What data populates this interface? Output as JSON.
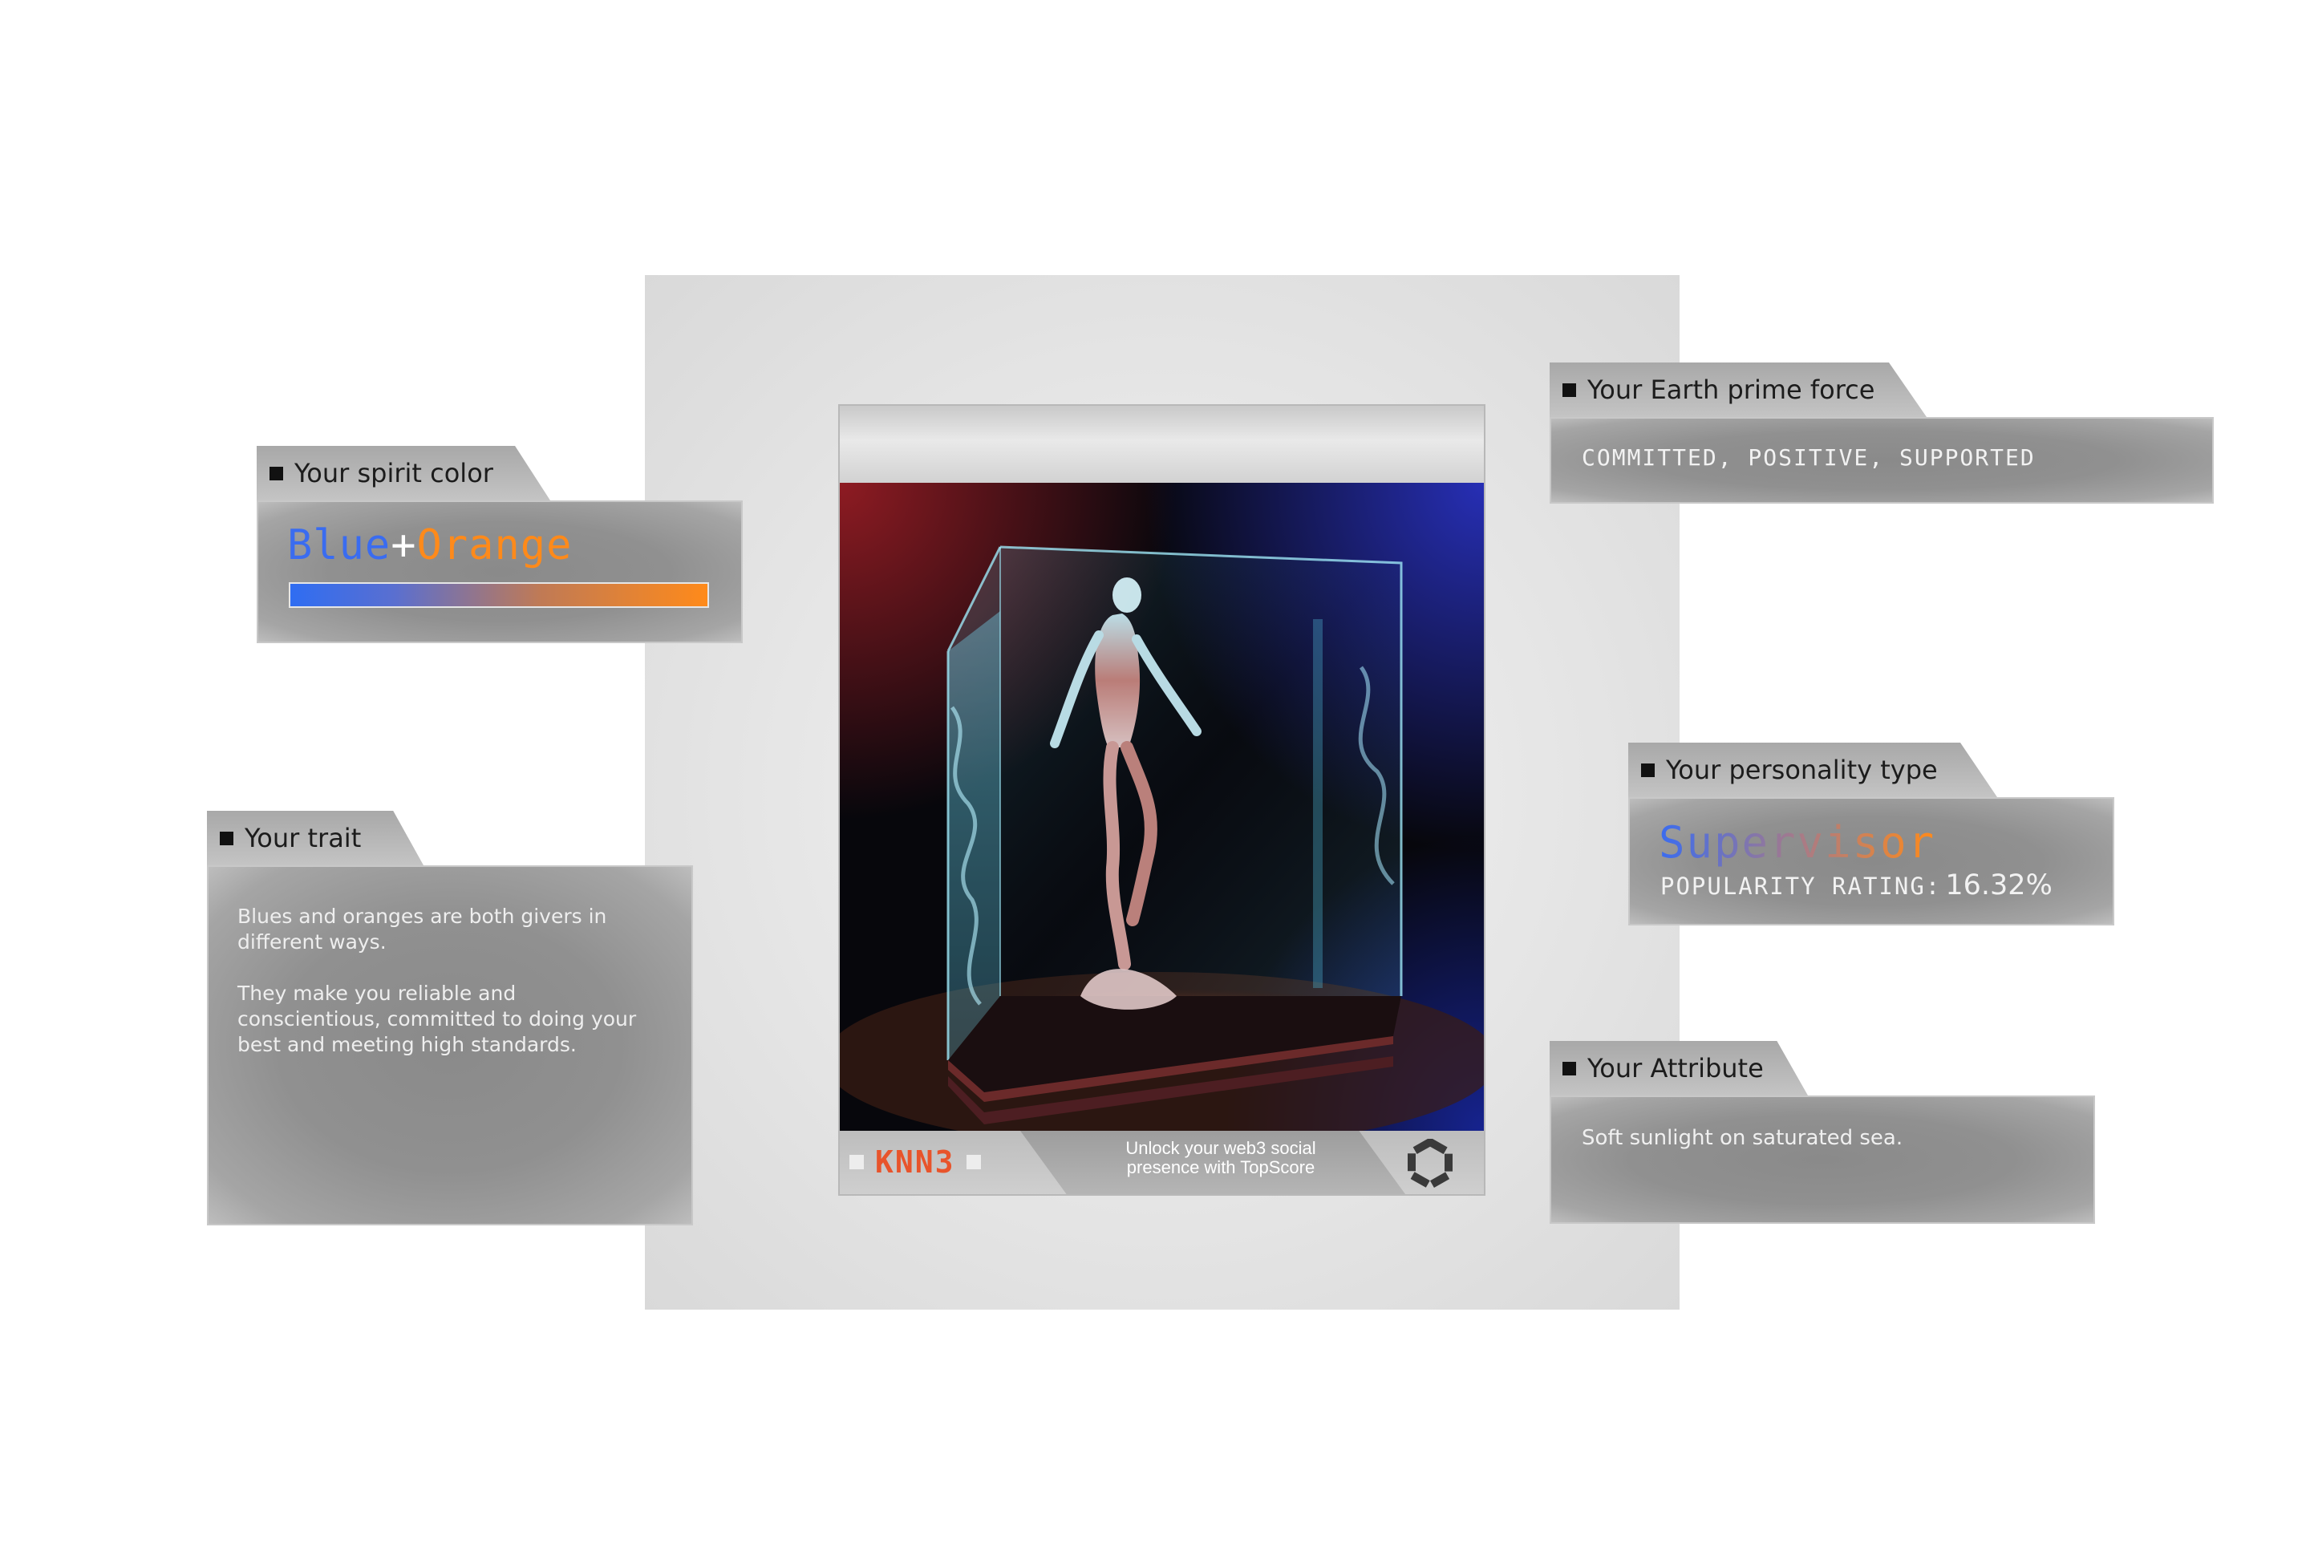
{
  "spirit_color": {
    "heading": "Your spirit color",
    "word_blue": "Blue",
    "plus": "+",
    "word_orange": "Orange",
    "colors": {
      "blue": "#3a6cf0",
      "orange": "#ff8a1a"
    }
  },
  "trait": {
    "heading": "Your trait",
    "paragraph_1": "Blues and oranges are both givers in different ways.",
    "paragraph_2": "They make you reliable and conscientious, committed to doing your best and meeting high standards."
  },
  "earth_prime_force": {
    "heading": "Your Earth prime force",
    "value": "COMMITTED, POSITIVE, SUPPORTED"
  },
  "personality": {
    "heading": "Your personality type",
    "type": "Supervisor",
    "rating_label": "POPULARITY RATING:",
    "rating_value": "16.32%"
  },
  "attribute": {
    "heading": "Your Attribute",
    "value": "Soft sunlight on saturated sea."
  },
  "card": {
    "logo_text": "KNN3",
    "tagline_line1": "Unlock your web3 social",
    "tagline_line2": "presence with TopScore",
    "footer_icon": "hexagon-ring-icon",
    "artwork": "glass-cube-figure-image"
  }
}
